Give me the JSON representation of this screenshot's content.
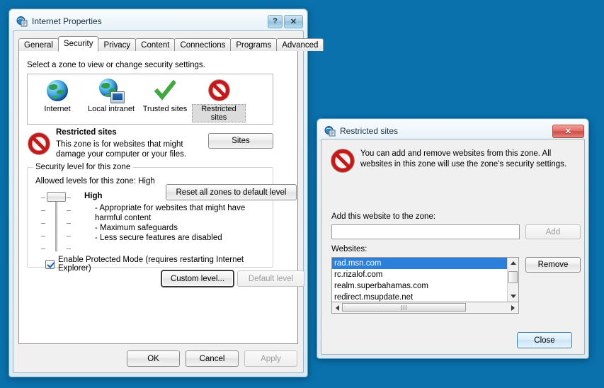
{
  "desktop": {
    "background_color": "#0a71ad"
  },
  "internet_properties": {
    "title": "Internet Properties",
    "title_icon": "internet-properties-icon",
    "help_button": "?",
    "close_button": "✕",
    "tabs": [
      {
        "label": "General",
        "active": false
      },
      {
        "label": "Security",
        "active": true
      },
      {
        "label": "Privacy",
        "active": false
      },
      {
        "label": "Content",
        "active": false
      },
      {
        "label": "Connections",
        "active": false
      },
      {
        "label": "Programs",
        "active": false
      },
      {
        "label": "Advanced",
        "active": false
      }
    ],
    "security": {
      "zone_prompt": "Select a zone to view or change security settings.",
      "zones": [
        {
          "label": "Internet",
          "icon": "globe-icon",
          "selected": false
        },
        {
          "label": "Local intranet",
          "icon": "globe-monitor-icon",
          "selected": false
        },
        {
          "label": "Trusted sites",
          "icon": "green-check-icon",
          "selected": false
        },
        {
          "label": "Restricted sites",
          "icon": "red-deny-icon",
          "selected": true
        }
      ],
      "selected_zone": {
        "icon": "red-deny-icon",
        "name": "Restricted sites",
        "description": "This zone is for websites that might damage your computer or your files."
      },
      "sites_button": "Sites",
      "level_group_title": "Security level for this zone",
      "allowed_levels": "Allowed levels for this zone: High",
      "slider": {
        "position": "High",
        "value": 1,
        "min": 1,
        "max": 5
      },
      "level_name": "High",
      "level_bullets": [
        "- Appropriate for websites that might have harmful content",
        "- Maximum safeguards",
        "- Less secure features are disabled"
      ],
      "protected_mode": {
        "label": "Enable Protected Mode (requires restarting Internet Explorer)",
        "checked": true
      },
      "custom_level_button": "Custom level...",
      "default_level_button": "Default level",
      "default_level_disabled": true,
      "reset_zones_button": "Reset all zones to default level"
    },
    "footer": {
      "ok": "OK",
      "cancel": "Cancel",
      "apply": "Apply",
      "apply_disabled": true
    }
  },
  "restricted_sites_dialog": {
    "title": "Restricted sites",
    "title_icon": "restricted-sites-icon",
    "close_button": "✕",
    "notice_icon": "red-deny-icon",
    "notice": "You can add and remove websites from this zone. All websites in this zone will use the zone's security settings.",
    "add_label": "Add this website to the zone:",
    "add_input": {
      "value": "",
      "placeholder": ""
    },
    "add_button": "Add",
    "add_button_disabled": true,
    "websites_label": "Websites:",
    "websites": [
      {
        "name": "rad.msn.com",
        "selected": true
      },
      {
        "name": "rc.rizalof.com",
        "selected": false
      },
      {
        "name": "realm.superbahamas.com",
        "selected": false
      },
      {
        "name": "redirect.msupdate.net",
        "selected": false
      }
    ],
    "remove_button": "Remove",
    "close_action_button": "Close",
    "scrollbars": {
      "vertical": true,
      "horizontal": true
    }
  }
}
